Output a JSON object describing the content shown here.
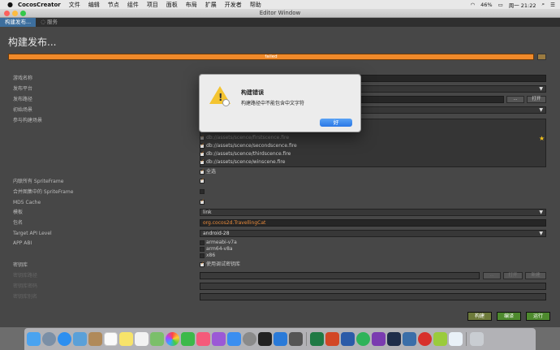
{
  "menubar": {
    "apple": "",
    "app_name": "CocosCreator",
    "items": [
      "文件",
      "编辑",
      "节点",
      "组件",
      "项目",
      "面板",
      "布局",
      "扩展",
      "开发者",
      "帮助"
    ],
    "status": {
      "battery": "46%",
      "datetime": "周一 21:22"
    }
  },
  "window": {
    "title": "Editor Window"
  },
  "tabs": [
    {
      "label": "构建发布..."
    },
    {
      "label": "服务"
    }
  ],
  "panel": {
    "title": "构建发布...",
    "progress_label": "failed",
    "labels": {
      "game_name": "游戏名称",
      "platform": "发布平台",
      "build_path": "发布路径",
      "start_scene": "初始场景",
      "scenes": "参与构建场景",
      "inline_sprite": "内联所有 SpriteFrame",
      "merge_atlas": "合并图集中的 SpriteFrame",
      "md5": "MD5 Cache",
      "template": "模板",
      "package": "包名",
      "api_level": "Target API Level",
      "app_abi": "APP ABI",
      "keystore": "密钥库",
      "keystore_path": "密钥库路径",
      "keystore_pw": "密钥库密码",
      "alias_pw": "密钥库别名"
    },
    "browse_label": "...",
    "open_label": "打开",
    "new_label": "新建",
    "scenes": [
      "db://assets/scence/firstscence.fire",
      "db://assets/scence/secondscence.fire",
      "db://assets/scence/thirdscence.fire",
      "db://assets/scence/winscene.fire"
    ],
    "select_all": "全选",
    "template_value": "link",
    "package_value": "org.cocos2d.TravellingCat",
    "api_value": "android-28",
    "abi_options": [
      "armeabi-v7a",
      "arm64-v8a",
      "x86"
    ],
    "use_debug_keystore": "使用调试密钥库"
  },
  "buttons": {
    "build": "构建",
    "compile": "编译",
    "run": "运行"
  },
  "dialog": {
    "title": "构建错误",
    "message": "构建路径中不能包含中文字符",
    "ok": "好"
  },
  "colors": {
    "accent": "#f08a2a",
    "primary_btn": "#2a77e6",
    "panel_bg": "#474747"
  },
  "dock": {
    "icons": [
      "finder-icon",
      "launchpad-icon",
      "safari-icon",
      "mail-icon",
      "contacts-icon",
      "calendar-icon",
      "notes-icon",
      "reminders-icon",
      "maps-icon",
      "photos-icon",
      "facetime-icon",
      "music-icon",
      "podcasts-icon",
      "appstore-icon",
      "settings-icon",
      "terminal-icon",
      "vscode-icon",
      "system-icon",
      "excel-icon",
      "powerpoint-icon",
      "word-icon",
      "evernote-icon",
      "onenote-icon",
      "pycharm-icon",
      "wireshark-icon",
      "netease-icon",
      "android-icon",
      "drop-icon",
      "trash-icon"
    ]
  }
}
